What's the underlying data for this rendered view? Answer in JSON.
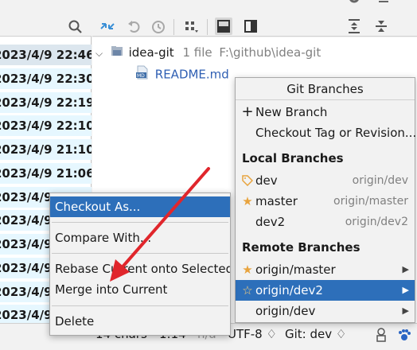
{
  "commit_list": {
    "rows": [
      "2023/4/9 22:46",
      "2023/4/9 22:30",
      "2023/4/9 22:19",
      "2023/4/9 22:10",
      "2023/4/9 21:10",
      "2023/4/9 21:06",
      "2023/4/9 21:00",
      "2023/4/9 2",
      "2023/4/9 2",
      "2023/4/9 2",
      "2023/4/9 2",
      "2023/4/9 2"
    ]
  },
  "file_tree": {
    "root_name": "idea-git",
    "root_count": "1 file",
    "root_path": "F:\\github\\idea-git",
    "file_name": "README.md"
  },
  "statusbar": {
    "chars": "14 chars",
    "position": "1:14",
    "na": "n/a",
    "encoding": "UTF-8 ♢",
    "branch": "Git: dev ♢"
  },
  "git_popup": {
    "title": "Git Branches",
    "new_branch": "New Branch",
    "checkout_tag": "Checkout Tag or Revision...",
    "local_header": "Local Branches",
    "local": [
      {
        "name": "dev",
        "remote": "origin/dev",
        "icon": "tag-icon"
      },
      {
        "name": "master",
        "remote": "origin/master",
        "icon": "star-icon"
      },
      {
        "name": "dev2",
        "remote": "origin/dev2",
        "icon": ""
      }
    ],
    "remote_header": "Remote Branches",
    "remote": [
      {
        "name": "origin/master",
        "icon": "star-icon"
      },
      {
        "name": "origin/dev2",
        "icon": "star-outline-icon"
      },
      {
        "name": "origin/dev",
        "icon": ""
      }
    ],
    "colors": {
      "selection": "#2d6fba",
      "star": "#e8a33d"
    }
  },
  "context_menu": {
    "items": [
      "Checkout As...",
      "Compare With...",
      "Rebase Current onto Selected",
      "Merge into Current",
      "Delete"
    ]
  },
  "annotation": {
    "color": "#e0262c"
  }
}
